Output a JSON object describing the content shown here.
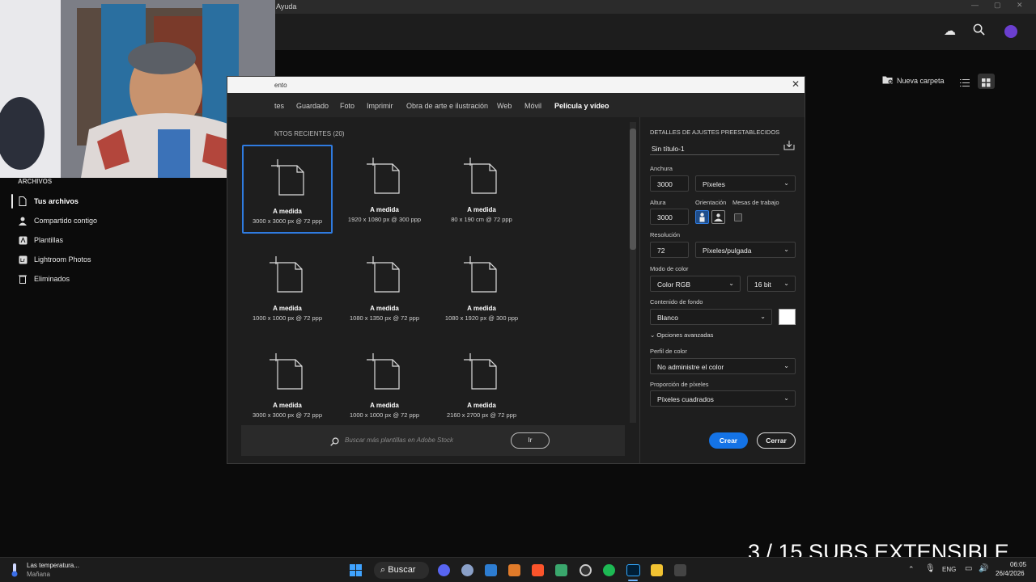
{
  "menubar": {
    "menu_label": "Ayuda"
  },
  "sidebar": {
    "section_title": "ARCHIVOS",
    "items": [
      {
        "label": "Tus archivos",
        "icon": "file-icon"
      },
      {
        "label": "Compartido contigo",
        "icon": "people-icon"
      },
      {
        "label": "Plantillas",
        "icon": "template-icon"
      },
      {
        "label": "Lightroom Photos",
        "icon": "lightroom-icon"
      },
      {
        "label": "Eliminados",
        "icon": "trash-icon"
      }
    ]
  },
  "toolbar": {
    "new_folder_label": "Nueva carpeta"
  },
  "dialog": {
    "title": "ento",
    "tabs": [
      "tes",
      "Guardado",
      "Foto",
      "Imprimir",
      "Obra de arte e ilustración",
      "Web",
      "Móvil",
      "Película y vídeo"
    ],
    "recent_label": "NTOS RECIENTES",
    "recent_count": "(20)",
    "presets": [
      {
        "name": "A medida",
        "dims": "3000 x 3000 px @ 72 ppp"
      },
      {
        "name": "A medida",
        "dims": "1920 x 1080 px @ 300 ppp"
      },
      {
        "name": "A medida",
        "dims": "80 x 190 cm @ 72 ppp"
      },
      {
        "name": "A medida",
        "dims": "1000 x 1000 px @ 72 ppp"
      },
      {
        "name": "A medida",
        "dims": "1080 x 1350 px @ 72 ppp"
      },
      {
        "name": "A medida",
        "dims": "1080 x 1920 px @ 300 ppp"
      },
      {
        "name": "A medida",
        "dims": "3000 x 3000 px @ 72 ppp"
      },
      {
        "name": "A medida",
        "dims": "1000 x 1000 px @ 72 ppp"
      },
      {
        "name": "A medida",
        "dims": "2160 x 2700 px @ 72 ppp"
      }
    ],
    "search_placeholder": "Buscar más plantillas en Adobe Stock",
    "go_label": "Ir",
    "details": {
      "header": "DETALLES DE AJUSTES PREESTABLECIDOS",
      "doc_name": "Sin título-1",
      "width_label": "Anchura",
      "width_value": "3000",
      "width_unit": "Píxeles",
      "height_label": "Altura",
      "height_value": "3000",
      "orientation_label": "Orientación",
      "artboards_label": "Mesas de trabajo",
      "resolution_label": "Resolución",
      "resolution_value": "72",
      "resolution_unit": "Píxeles/pulgada",
      "color_mode_label": "Modo de color",
      "color_mode_value": "Color RGB",
      "bit_depth_value": "16 bit",
      "background_label": "Contenido de fondo",
      "background_value": "Blanco",
      "advanced_label": "Opciones avanzadas",
      "color_profile_label": "Perfil de color",
      "color_profile_value": "No administre el color",
      "pixel_aspect_label": "Proporción de píxeles",
      "pixel_aspect_value": "Píxeles cuadrados",
      "create_label": "Crear",
      "close_label": "Cerrar"
    }
  },
  "overlay_text": "3 / 15 SUBS EXTENSIBLE",
  "taskbar": {
    "weather_title": "Las temperatura...",
    "weather_sub": "Mañana",
    "search_label": "Buscar",
    "lang": "ENG",
    "time": "06:05",
    "date": "26/4/2026"
  },
  "colors": {
    "accent": "#1473e6",
    "selection": "#2f7be0"
  }
}
